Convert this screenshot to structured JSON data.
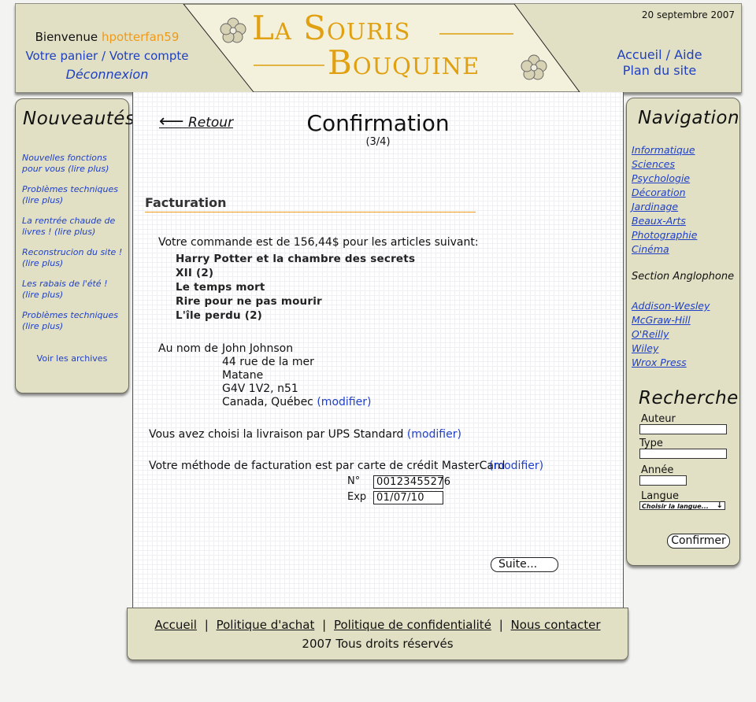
{
  "header": {
    "welcome": "Bienvenue",
    "username": "hpotterfan59",
    "cart": "Votre panier",
    "sep": "/",
    "account": "Votre compte",
    "logout": "Déconnexion",
    "logo_line1": "La Souris",
    "logo_line2": "Bouquine",
    "date": "20 septembre 2007",
    "home": "Accueil",
    "help": "Aide",
    "sitemap": "Plan du site"
  },
  "left": {
    "title": "Nouveautés",
    "items": [
      {
        "l1": "Nouvelles fonctions",
        "l2": "pour vous (lire plus)"
      },
      {
        "l1": "Problèmes techniques",
        "l2": "(lire plus)"
      },
      {
        "l1": "La rentrée chaude de",
        "l2": "livres ! (lire plus)"
      },
      {
        "l1": "Reconstrucion du site !",
        "l2": "(lire plus)"
      },
      {
        "l1": "Les rabais de l'été !",
        "l2": "(lire plus)"
      },
      {
        "l1": "Problèmes techniques",
        "l2": "(lire plus)"
      }
    ],
    "archives": "Voir les archives"
  },
  "main": {
    "back": "Retour",
    "title": "Confirmation",
    "step": "(3/4)",
    "section": "Facturation",
    "order_text": "Votre commande est de 156,44$ pour les articles suivant:",
    "books": [
      "Harry Potter et la chambre des secrets",
      "XII (2)",
      "Le temps mort",
      "Rire pour ne pas mourir",
      "L'île perdu (2)"
    ],
    "name_label": "Au nom de",
    "address": [
      "John Johnson",
      "44 rue de la mer",
      "Matane",
      "G4V 1V2, n51",
      "Canada, Québec"
    ],
    "modify": "(modifier)",
    "shipping": "Vous avez choisi la livraison par UPS Standard",
    "billing": "Votre méthode de facturation est par carte de crédit MasterCard",
    "card_no_label": "N°",
    "card_no": "00123455276",
    "exp_label": "Exp",
    "exp": "01/07/10",
    "next": "Suite..."
  },
  "right": {
    "title": "Navigation",
    "categories": [
      "Informatique",
      "Sciences",
      "Psychologie",
      "Décoration",
      "Jardinage",
      "Beaux-Arts",
      "Photographie",
      "Cinéma"
    ],
    "english_title": "Section Anglophone",
    "publishers": [
      "Addison-Wesley",
      "McGraw-Hill",
      "O'Reilly",
      "Wiley",
      "Wrox Press"
    ],
    "search_title": "Recherche",
    "author": "Auteur",
    "type": "Type",
    "year": "Année",
    "language": "Langue",
    "language_select": "Choisir la langue...",
    "confirm": "Confirmer"
  },
  "footer": {
    "home": "Accueil",
    "purchase": "Politique d'achat",
    "privacy": "Politique de confidentialité",
    "contact": "Nous contacter",
    "sep": "|",
    "copyright": "2007 Tous droits réservés"
  },
  "colors": {
    "accent": "#ef9a1a",
    "link": "#1f3fc8",
    "panel": "#e1e0c4"
  }
}
